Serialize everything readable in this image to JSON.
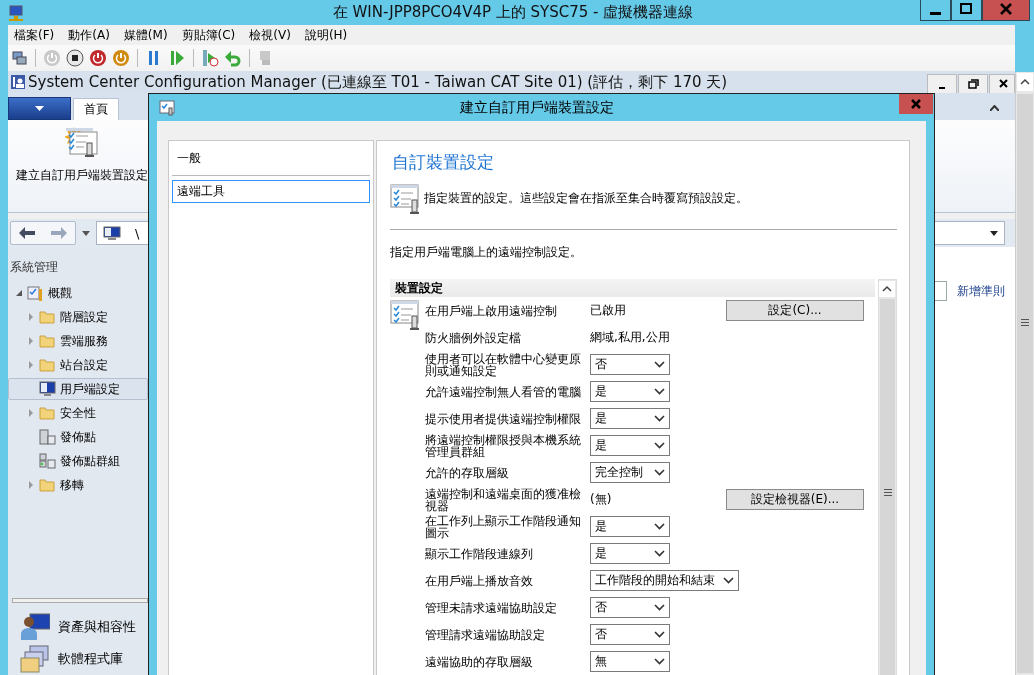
{
  "window": {
    "title": "在 WIN-JPP8PCO4V4P 上的 SYSC75 - 虛擬機器連線"
  },
  "menu": [
    "檔案(F)",
    "動作(A)",
    "媒體(M)",
    "剪貼簿(C)",
    "檢視(V)",
    "說明(H)"
  ],
  "app": {
    "title": "System Center Configuration Manager (已連線至 T01 - Taiwan CAT Site 01) (評估，剩下 170 天)",
    "ribbon_tabs": [
      {
        "label": "首頁",
        "selected": true
      }
    ],
    "ribbon_button": "建立自訂用戶端裝置設定",
    "breadcrumb": "\\",
    "workspace_title": "系統管理",
    "tree": [
      {
        "label": "概觀",
        "kind": "overview",
        "expanded": true,
        "selected": false,
        "children": [
          {
            "label": "階層設定",
            "kind": "folder",
            "expanded": false,
            "selected": false
          },
          {
            "label": "雲端服務",
            "kind": "folder",
            "expanded": false,
            "selected": false
          },
          {
            "label": "站台設定",
            "kind": "folder",
            "expanded": false,
            "selected": false
          },
          {
            "label": "用戶端設定",
            "kind": "monitor",
            "selected": true
          },
          {
            "label": "安全性",
            "kind": "folder",
            "expanded": false,
            "selected": false
          },
          {
            "label": "發佈點",
            "kind": "server",
            "selected": false
          },
          {
            "label": "發佈點群組",
            "kind": "servers",
            "selected": false
          },
          {
            "label": "移轉",
            "kind": "folder",
            "expanded": false,
            "selected": false
          }
        ]
      }
    ],
    "workspaces": [
      {
        "label": "資產與相容性",
        "kind": "person"
      },
      {
        "label": "軟體程式庫",
        "kind": "boxes"
      }
    ],
    "link": "新增準則"
  },
  "dialog": {
    "title": "建立自訂用戶端裝置設定",
    "pages": [
      {
        "label": "一般",
        "selected": false
      },
      {
        "label": "遠端工具",
        "selected": true
      }
    ],
    "heading": "自訂裝置設定",
    "description": "指定裝置的設定。這些設定會在指派至集合時覆寫預設設定。",
    "intro": "指定用戶端電腦上的遠端控制設定。",
    "group": "裝置設定",
    "settings": [
      {
        "kind": "text",
        "label": "在用戶端上啟用遠端控制",
        "value": "已啟用",
        "button": "設定(C)..."
      },
      {
        "kind": "text",
        "label": "防火牆例外設定檔",
        "value": "網域,私用,公用"
      },
      {
        "kind": "select",
        "label": "使用者可以在軟體中心變更原則或通知設定",
        "value": "否"
      },
      {
        "kind": "select",
        "label": "允許遠端控制無人看管的電腦",
        "value": "是"
      },
      {
        "kind": "select",
        "label": "提示使用者提供遠端控制權限",
        "value": "是"
      },
      {
        "kind": "select",
        "label": "將遠端控制權限授與本機系統管理員群組",
        "value": "是"
      },
      {
        "kind": "select",
        "label": "允許的存取層級",
        "value": "完全控制"
      },
      {
        "kind": "text",
        "label": "遠端控制和遠端桌面的獲准檢視器",
        "value": "(無)",
        "button": "設定檢視器(E)..."
      },
      {
        "kind": "select",
        "label": "在工作列上顯示工作階段通知圖示",
        "value": "是"
      },
      {
        "kind": "select",
        "label": "顯示工作階段連線列",
        "value": "是"
      },
      {
        "kind": "select",
        "label": "在用戶端上播放音效",
        "value": "工作階段的開始和結束"
      },
      {
        "kind": "select",
        "label": "管理未請求遠端協助設定",
        "value": "否"
      },
      {
        "kind": "select",
        "label": "管理請求遠端協助設定",
        "value": "否"
      },
      {
        "kind": "select",
        "label": "遠端協助的存取層級",
        "value": "無"
      }
    ]
  }
}
